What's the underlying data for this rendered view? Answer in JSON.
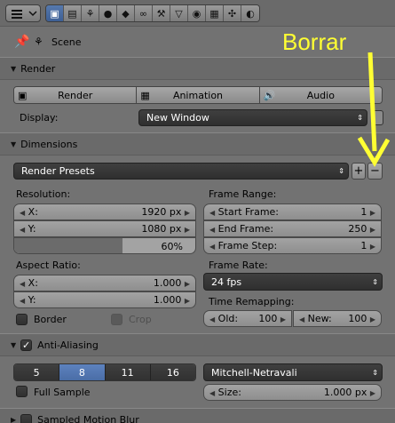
{
  "context": {
    "scene_label": "Scene"
  },
  "render": {
    "title": "Render",
    "render_btn": "Render",
    "animation_btn": "Animation",
    "audio_btn": "Audio",
    "display_label": "Display:",
    "display_value": "New Window"
  },
  "dimensions": {
    "title": "Dimensions",
    "presets_value": "Render Presets",
    "resolution_label": "Resolution:",
    "res_x_label": "X:",
    "res_x_value": "1920 px",
    "res_y_label": "Y:",
    "res_y_value": "1080 px",
    "res_pct": "60%",
    "res_pct_fraction": 0.6,
    "aspect_label": "Aspect Ratio:",
    "asp_x_label": "X:",
    "asp_x_value": "1.000",
    "asp_y_label": "Y:",
    "asp_y_value": "1.000",
    "border_label": "Border",
    "crop_label": "Crop",
    "frame_range_label": "Frame Range:",
    "start_label": "Start Frame:",
    "start_value": "1",
    "end_label": "End Frame:",
    "end_value": "250",
    "step_label": "Frame Step:",
    "step_value": "1",
    "frame_rate_label": "Frame Rate:",
    "frame_rate_value": "24 fps",
    "time_remap_label": "Time Remapping:",
    "old_label": "Old:",
    "old_value": "100",
    "new_label": "New:",
    "new_value": "100"
  },
  "antialiasing": {
    "title": "Anti-Aliasing",
    "samples": [
      "5",
      "8",
      "11",
      "16"
    ],
    "selected_sample": "8",
    "filter_value": "Mitchell-Netravali",
    "full_sample_label": "Full Sample",
    "size_label": "Size:",
    "size_value": "1.000 px"
  },
  "motion_blur": {
    "title": "Sampled Motion Blur"
  },
  "annotation": {
    "text": "Borrar",
    "color": "#ffff33"
  }
}
